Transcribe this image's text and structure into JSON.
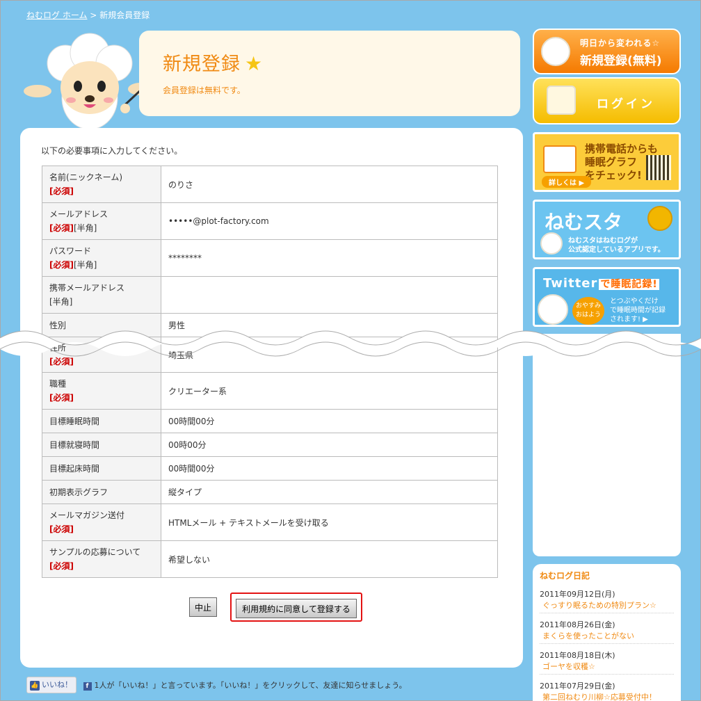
{
  "breadcrumb": {
    "home": "ねむログ ホーム",
    "sep": ">",
    "current": "新規会員登録"
  },
  "header": {
    "title": "新規登録",
    "star": "★",
    "subtitle": "会員登録は無料です。"
  },
  "form": {
    "intro": "以下の必要事項に入力してください。",
    "required_mark": "[必須]",
    "halfwidth_mark": "[半角]",
    "rows": [
      {
        "label": "名前(ニックネーム)",
        "required": true,
        "halfwidth": false,
        "value": "のりさ"
      },
      {
        "label": "メールアドレス",
        "required": true,
        "halfwidth": true,
        "value": "•••••@plot-factory.com"
      },
      {
        "label": "パスワード",
        "required": true,
        "halfwidth": true,
        "value": "********"
      },
      {
        "label": "携帯メールアドレス",
        "required": false,
        "halfwidth": true,
        "value": ""
      },
      {
        "label": "性別",
        "required": false,
        "halfwidth": false,
        "value": "男性"
      },
      {
        "label": "住所",
        "required": true,
        "halfwidth": false,
        "value": "埼玉県"
      },
      {
        "label": "職種",
        "required": true,
        "halfwidth": false,
        "value": "クリエーター系"
      },
      {
        "label": "目標睡眠時間",
        "required": false,
        "halfwidth": false,
        "value": "00時間00分"
      },
      {
        "label": "目標就寝時間",
        "required": false,
        "halfwidth": false,
        "value": "00時00分"
      },
      {
        "label": "目標起床時間",
        "required": false,
        "halfwidth": false,
        "value": "00時間00分"
      },
      {
        "label": "初期表示グラフ",
        "required": false,
        "halfwidth": false,
        "value": "縦タイプ"
      },
      {
        "label": "メールマガジン送付",
        "required": true,
        "halfwidth": false,
        "value": "HTMLメール + テキストメールを受け取る"
      },
      {
        "label": "サンプルの応募について",
        "required": true,
        "halfwidth": false,
        "value": "希望しない"
      }
    ],
    "cancel_label": "中止",
    "submit_label": "利用規約に同意して登録する"
  },
  "social": {
    "like_label": "いいね！",
    "like_text": "1人が「いいね！」と言っています。「いいね！」をクリックして、友達に知らせましょう。"
  },
  "sidebar": {
    "register": {
      "small": "明日から変われる☆",
      "big": "新規登録(無料)"
    },
    "login": {
      "label": "ログイン"
    },
    "banner_mobile": {
      "title_line1": "携帯電話からも",
      "title_line2": "睡眠グラフ",
      "title_line3": "をチェック!",
      "more": "詳しくは ▶"
    },
    "banner_nemusta": {
      "title": "ねむスタ",
      "sub_line1": "ねむスタはねむログが",
      "sub_line2": "公式認定しているアプリです。"
    },
    "banner_twitter": {
      "title": "Twitter",
      "title_accent": "で睡眠記録!",
      "bubble_line1": "おやすみ",
      "bubble_line2": "おはよう",
      "sub_line1": "とつぶやくだけ",
      "sub_line2": "で睡眠時間が記録",
      "sub_line3": "されます! ▶"
    },
    "diary": {
      "heading": "ねむログ日記",
      "entries": [
        {
          "date": "2011年09月12日(月)",
          "title": "ぐっすり眠るための特別プラン☆"
        },
        {
          "date": "2011年08月26日(金)",
          "title": "まくらを使ったことがない"
        },
        {
          "date": "2011年08月18日(木)",
          "title": "ゴーヤを収穫☆"
        },
        {
          "date": "2011年07月29日(金)",
          "title": "第二回ねむり川柳☆応募受付中！"
        }
      ]
    }
  },
  "colors": {
    "background": "#7dc4ec",
    "accent_orange": "#f08a13",
    "required_red": "#cc0000",
    "highlight_red": "#e31212"
  }
}
